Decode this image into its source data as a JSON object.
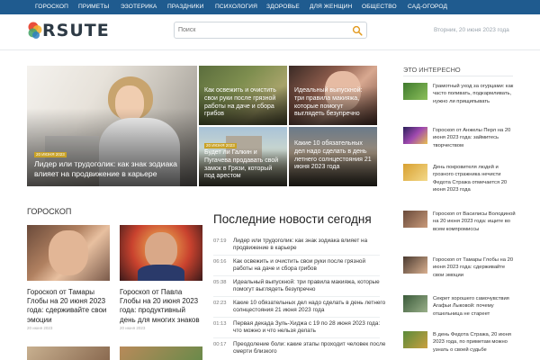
{
  "nav": {
    "items": [
      "Гороскоп",
      "Приметы",
      "Эзотерика",
      "Праздники",
      "Психология",
      "Здоровье",
      "Для женщин",
      "Общество",
      "Сад-огород"
    ]
  },
  "header": {
    "logo_text": "RSUTE",
    "search_placeholder": "Поиск",
    "date": "Вторник, 20 июня 2023 года"
  },
  "featured": [
    {
      "category": "20 июня 2023",
      "title": "Лидер или трудоголик: как знак зодиака влияет на продвижение в карьере"
    },
    {
      "category": "",
      "title": "Как освежить и очистить свои руки после грязной работы на даче и сбора грибов"
    },
    {
      "category": "",
      "title": "Идеальный выпускной: три правила макияжа, которые помогут выглядеть безупречно"
    },
    {
      "category": "20 июня 2023",
      "title": "Будет ли Галкин и Пугачева продавать свой замок в Грязи, который под арестом"
    },
    {
      "category": "",
      "title": "Какие 10 обязательных дел надо сделать в день летнего солнцестояния 21 июня 2023 года"
    }
  ],
  "horoscope": {
    "section_title": "Гороскоп",
    "cards": [
      {
        "title": "Гороскоп от Тамары Глобы на 20 июня 2023 года: сдерживайте свои эмоции",
        "date": "20 июня 2023"
      },
      {
        "title": "Гороскоп от Павла Глобы на 20 июня 2023 года: продуктивный день для многих знаков",
        "date": "20 июня 2023"
      }
    ]
  },
  "latest": {
    "title": "Последние новости сегодня",
    "items": [
      {
        "time": "07:19",
        "text": "Лидер или трудоголик: как знак зодиака влияет на продвижение в карьере"
      },
      {
        "time": "06:16",
        "text": "Как освежить и очистить свои руки после грязной работы на даче и сбора грибов"
      },
      {
        "time": "05:38",
        "text": "Идеальный выпускной: три правила макияжа, которые помогут выглядеть безупречно"
      },
      {
        "time": "02:23",
        "text": "Какие 10 обязательных дел надо сделать в день летнего солнцестояния 21 июня 2023 года"
      },
      {
        "time": "01:13",
        "text": "Первая декада Зуль-Хиджа с 19 по 28 июня 2023 года: что можно и что нельзя делать"
      },
      {
        "time": "00:17",
        "text": "Преодоление боли: какие этапы проходит человек после смерти близкого"
      }
    ]
  },
  "sidebar": {
    "title": "Это интересно",
    "items": [
      {
        "text": "Грамотный уход за огурцами: как часто поливать, подкармливать, нужно ли прищипывать"
      },
      {
        "text": "Гороскоп от Анжелы Перл на 20 июня 2023 года: займитесь творчеством"
      },
      {
        "text": "День покровителя людей и грозного стражника нечисти Федота Стража отмечается 20 июня 2023 года"
      },
      {
        "text": "Гороскоп от Василисы Володиной на 20 июня 2023 года: ищите во всем компромиссы"
      },
      {
        "text": "Гороскоп от Тамары Глобы на 20 июня 2023 года: сдерживайте свои эмоции"
      },
      {
        "text": "Секрет хорошего самочувствия Агафьи Лыковой: почему отшельница не стареет"
      },
      {
        "text": "В день Федота Стража, 20 июня 2023 года, по приметам можно узнать о своей судьбе"
      }
    ]
  }
}
